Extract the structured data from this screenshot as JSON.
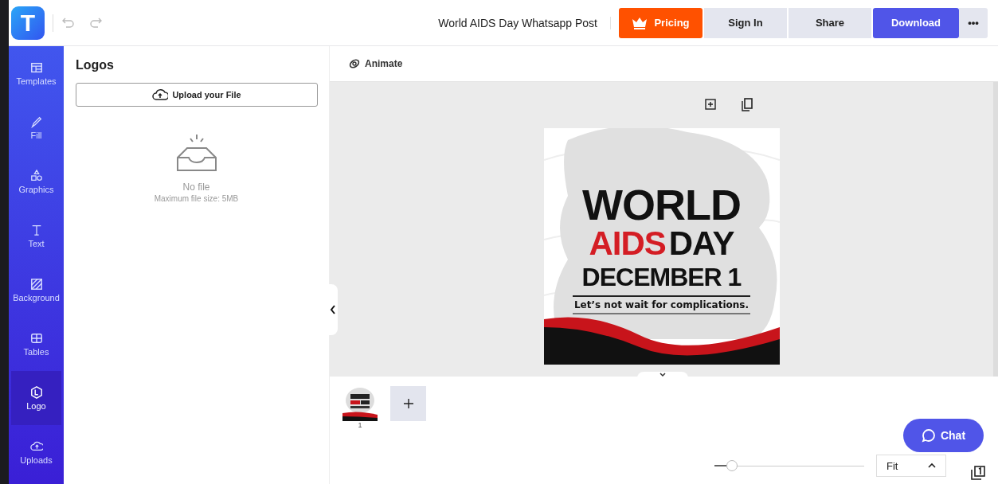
{
  "app": {
    "logo": "T",
    "title": "World AIDS Day Whatsapp Post"
  },
  "header_buttons": [
    {
      "label": "Pricing",
      "kind": "pricing"
    },
    {
      "label": "Sign In",
      "kind": "plain"
    },
    {
      "label": "Share",
      "kind": "plain"
    },
    {
      "label": "Download",
      "kind": "primary"
    },
    {
      "label": "•••",
      "kind": "more"
    }
  ],
  "sidebar": {
    "items": [
      {
        "label": "Templates",
        "selected": false
      },
      {
        "label": "Fill",
        "selected": false
      },
      {
        "label": "Graphics",
        "selected": false
      },
      {
        "label": "Text",
        "selected": false
      },
      {
        "label": "Background",
        "selected": false
      },
      {
        "label": "Tables",
        "selected": false
      },
      {
        "label": "Logo",
        "selected": true
      },
      {
        "label": "Uploads",
        "selected": false
      }
    ]
  },
  "panel": {
    "title": "Logos",
    "upload_button": "Upload your File",
    "empty_title": "No file",
    "empty_hint": "Maximum file size: 5MB"
  },
  "toolbar": {
    "animate": "Animate"
  },
  "design": {
    "line_1": "WORLD",
    "line_2_red": "AIDS",
    "line_2": "DAY",
    "line_3": "DECEMBER 1",
    "tagline": "Let’s not wait for complications."
  },
  "pages": [
    {
      "number": "1"
    }
  ],
  "zoom": {
    "level": 0.08,
    "fit": "Fit"
  },
  "chat": {
    "label": "Chat"
  }
}
